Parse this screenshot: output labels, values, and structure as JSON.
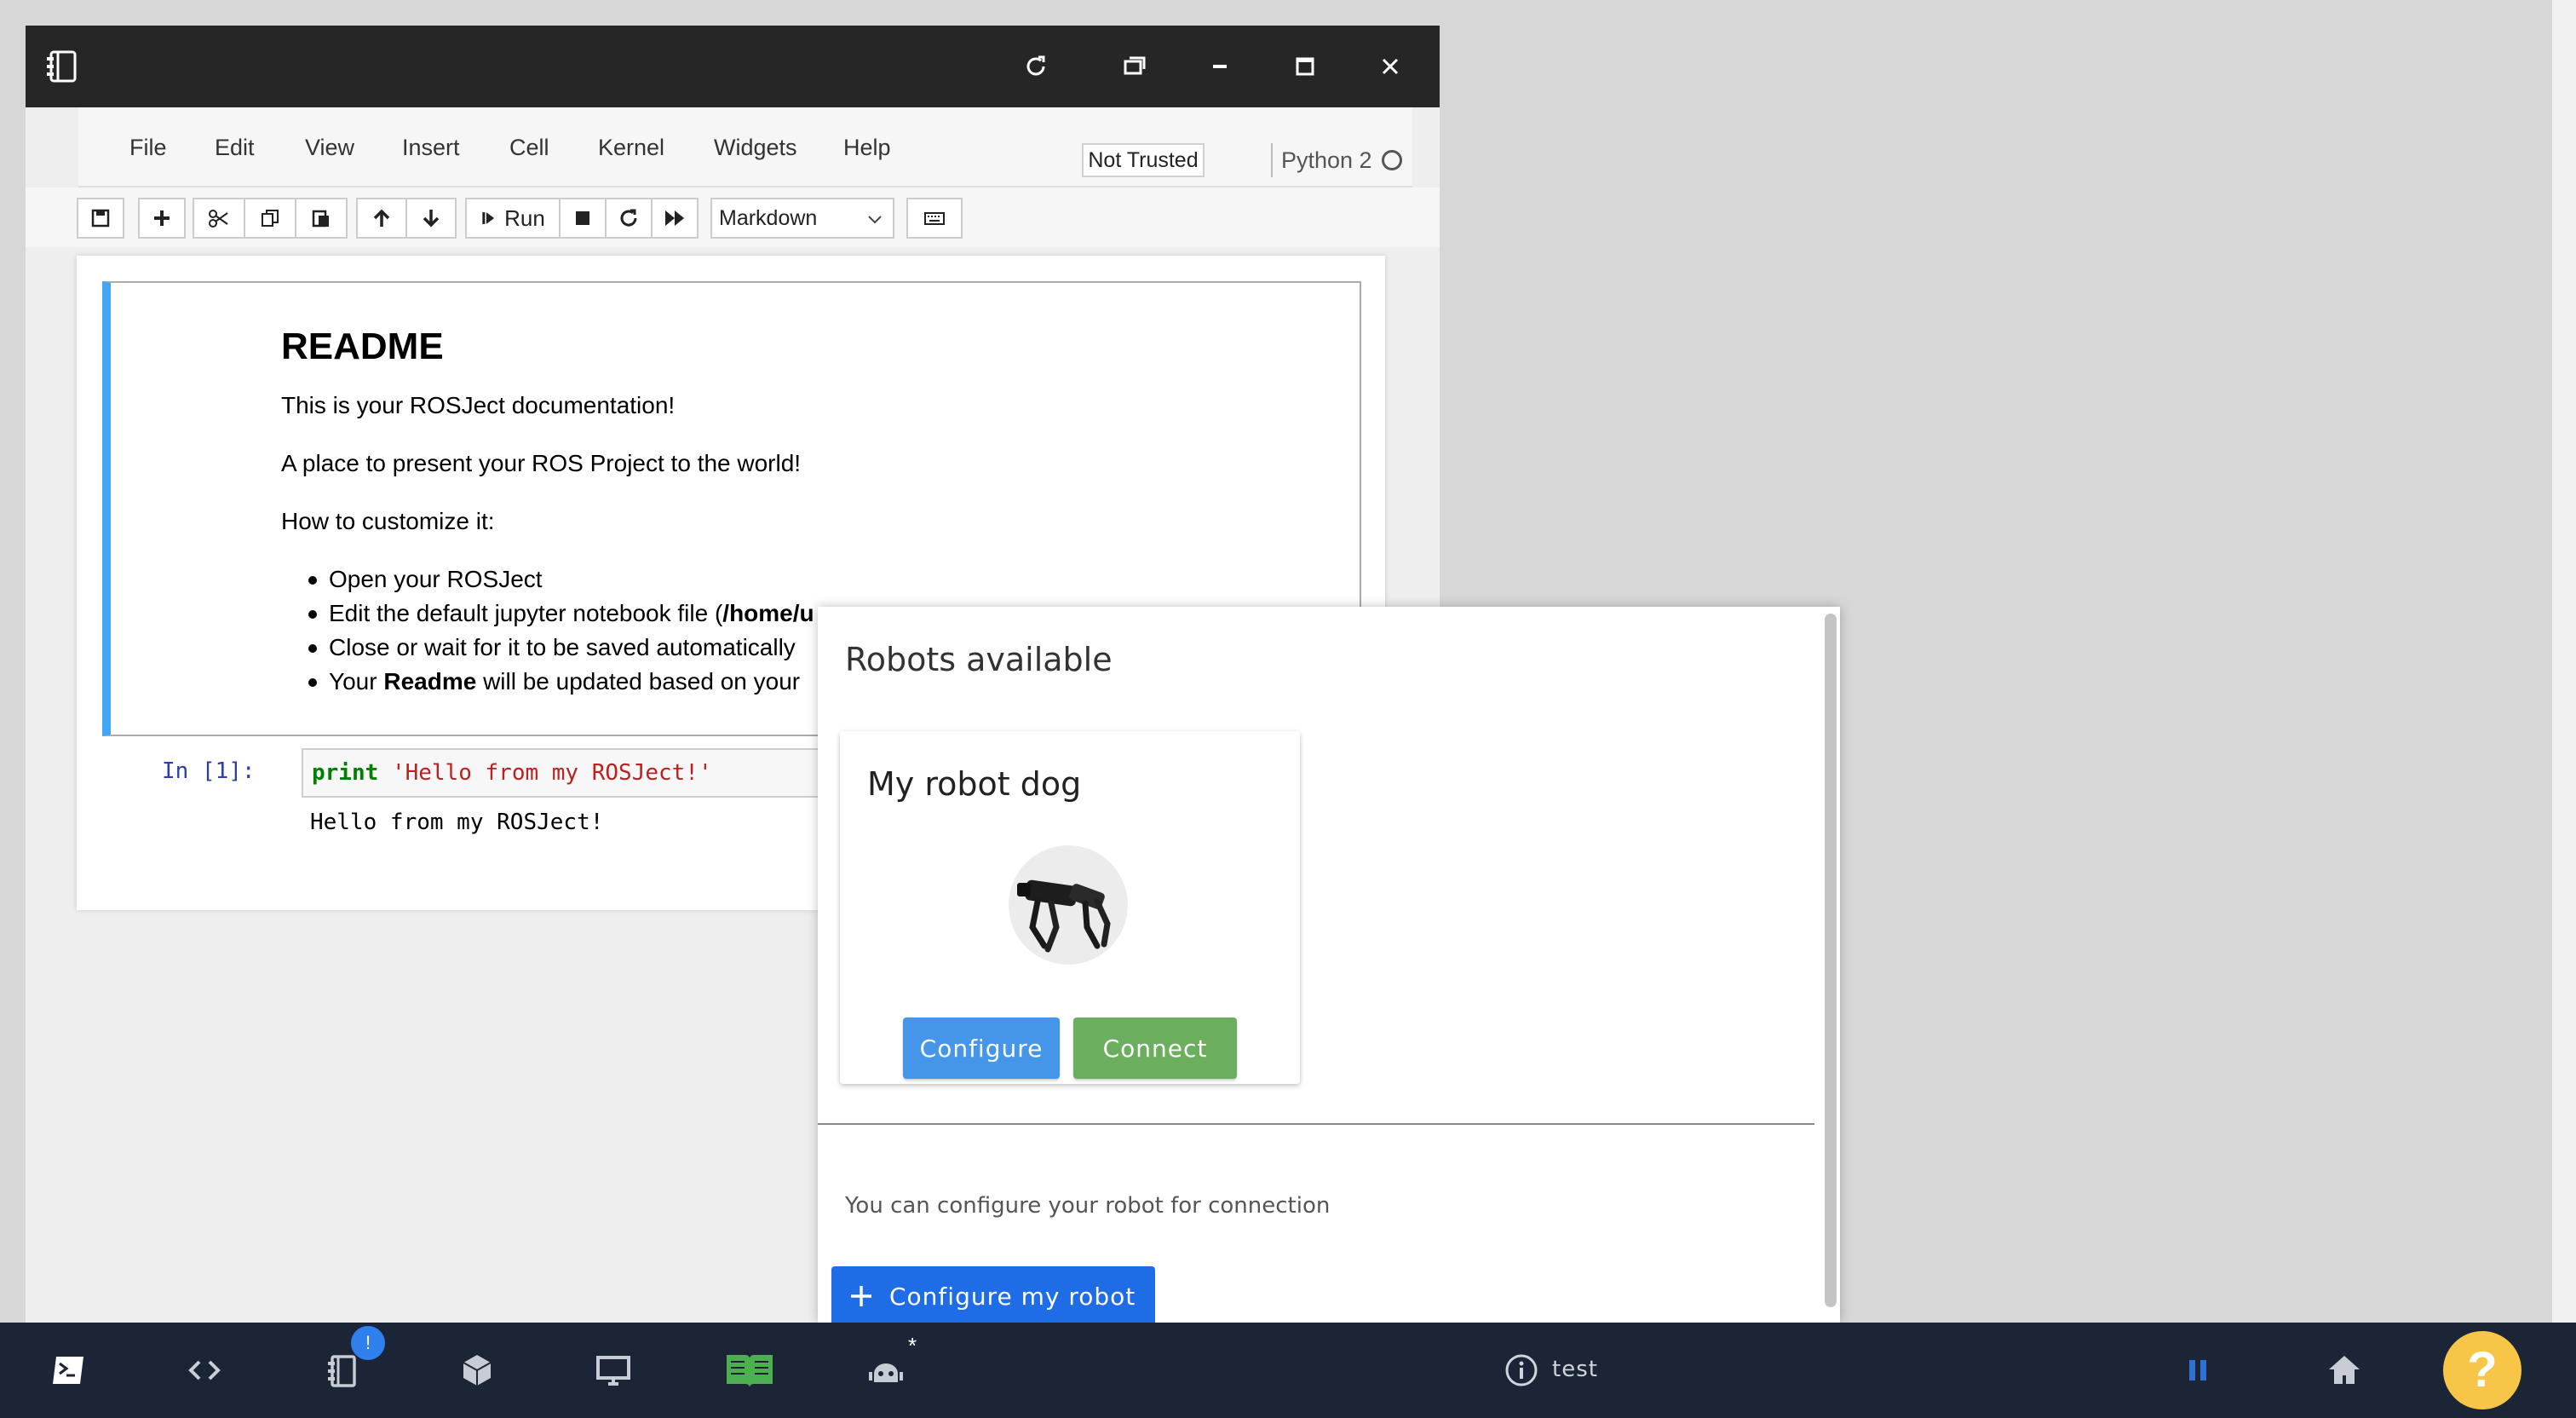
{
  "menu": [
    "File",
    "Edit",
    "View",
    "Insert",
    "Cell",
    "Kernel",
    "Widgets",
    "Help"
  ],
  "trust_status": "Not Trusted",
  "kernel_name": "Python 2",
  "toolbar": {
    "run_label": "Run",
    "cell_type": "Markdown"
  },
  "markdown_cell": {
    "heading": "README",
    "p1": "This is your ROSJect documentation!",
    "p2": "A place to present your ROS Project to the world!",
    "p3": "How to customize it:",
    "bullets": [
      {
        "text": "Open your ROSJect"
      },
      {
        "prefix": "Edit the default jupyter notebook file (",
        "bold": "/home/u"
      },
      {
        "text": "Close or wait for it to be saved automatically"
      },
      {
        "prefix": "Your ",
        "bold": "Readme",
        "suffix": " will be updated based on your"
      }
    ]
  },
  "code_cell": {
    "prompt": "In [1]:",
    "keyword": "print",
    "string": "'Hello from my ROSJect!'",
    "output": "Hello from my ROSJect!"
  },
  "robots_panel": {
    "title": "Robots available",
    "robot": {
      "name": "My robot dog",
      "configure_label": "Configure",
      "connect_label": "Connect"
    },
    "hint": "You can configure your robot for connection",
    "configure_my_label": "Configure my robot"
  },
  "dock": {
    "notebook_badge": "!",
    "robot_marker": "*",
    "session_name": "test",
    "help_label": "?"
  },
  "colors": {
    "configure_button": "#4596e8",
    "connect_button": "#6bae5e",
    "primary_button": "#1e6ce6",
    "help_button": "#f7c547",
    "dock_background": "#1b2535"
  }
}
